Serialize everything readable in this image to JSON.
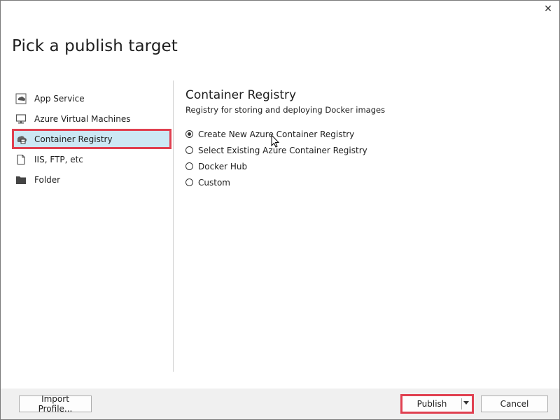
{
  "dialog": {
    "title": "Pick a publish target",
    "close_glyph": "✕"
  },
  "sidebar": {
    "items": [
      {
        "label": "App Service",
        "icon": "app-service-icon",
        "selected": false
      },
      {
        "label": "Azure Virtual Machines",
        "icon": "virtual-machine-icon",
        "selected": false
      },
      {
        "label": "Container Registry",
        "icon": "container-registry-icon",
        "selected": true
      },
      {
        "label": "IIS, FTP, etc",
        "icon": "file-icon",
        "selected": false
      },
      {
        "label": "Folder",
        "icon": "folder-icon",
        "selected": false
      }
    ]
  },
  "content": {
    "title": "Container Registry",
    "subtitle": "Registry for storing and deploying Docker images",
    "options": [
      {
        "label": "Create New Azure Container Registry",
        "checked": true
      },
      {
        "label": "Select Existing Azure Container Registry",
        "checked": false
      },
      {
        "label": "Docker Hub",
        "checked": false
      },
      {
        "label": "Custom",
        "checked": false
      }
    ]
  },
  "footer": {
    "import_label": "Import Profile...",
    "publish_label": "Publish",
    "cancel_label": "Cancel"
  },
  "colors": {
    "selection_bg": "#cce8f4",
    "highlight_border": "#e04050",
    "footer_bg": "#f0f0f0"
  }
}
